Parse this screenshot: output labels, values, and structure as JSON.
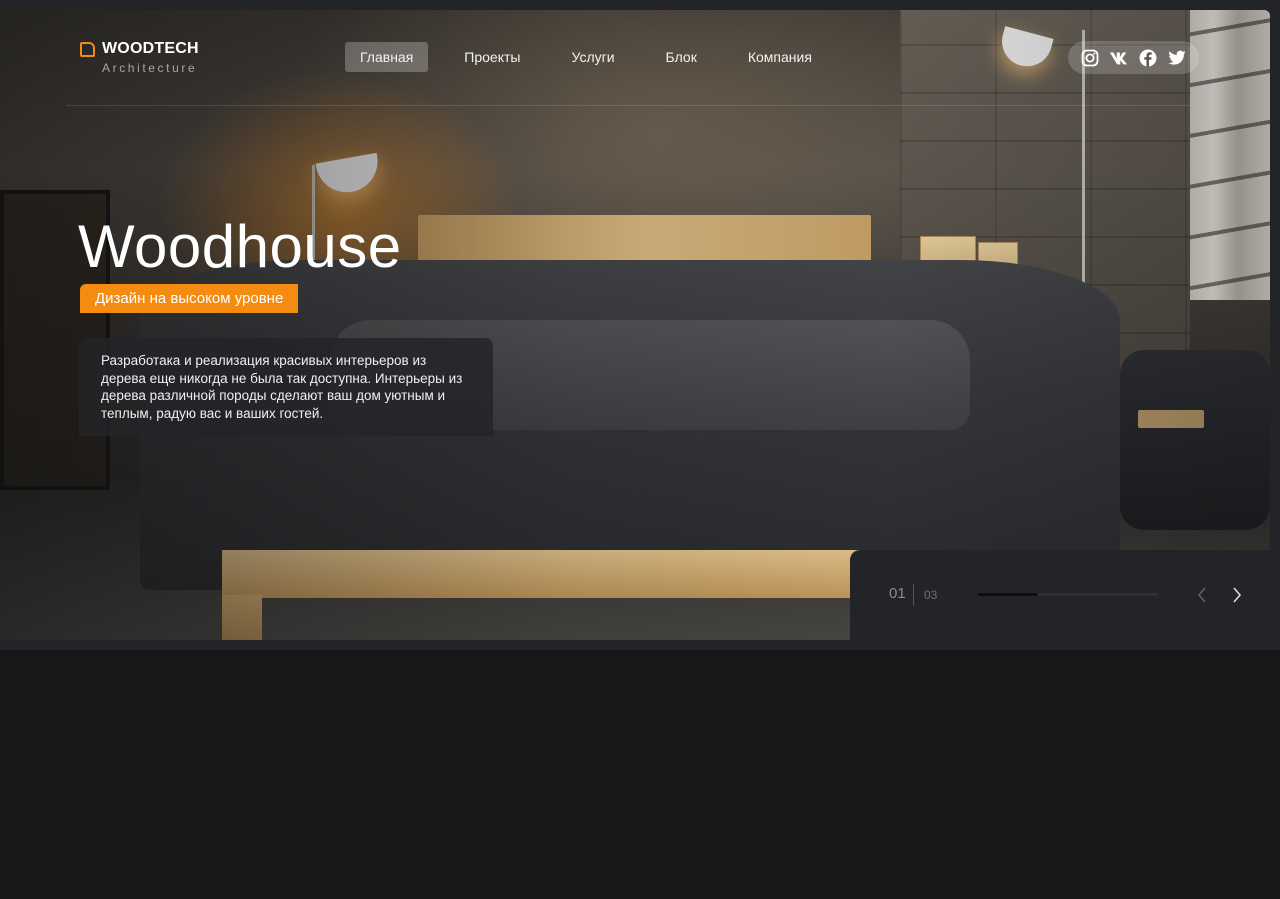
{
  "brand": {
    "name": "WOODTECH",
    "tagline": "Architecture",
    "accent_color": "#f58c12"
  },
  "nav": {
    "items": [
      {
        "label": "Главная",
        "active": true
      },
      {
        "label": "Проекты",
        "active": false
      },
      {
        "label": "Услуги",
        "active": false
      },
      {
        "label": "Блок",
        "active": false
      },
      {
        "label": "Компания",
        "active": false
      }
    ]
  },
  "social": {
    "icons": [
      "instagram-icon",
      "vk-icon",
      "facebook-icon",
      "twitter-icon"
    ]
  },
  "hero": {
    "title": "Woodhouse",
    "tag": "Дизайн на высоком уровне",
    "description": "Разработака и реализация красивых интерьеров из дерева еще никогда не была так доступна. Интерьеры из дерева различной породы сделают ваш дом уютным и теплым, радую вас и ваших гостей."
  },
  "slider": {
    "current": "01",
    "total": "03",
    "progress": 0.333,
    "prev_icon": "chevron-left-icon",
    "next_icon": "chevron-right-icon"
  }
}
